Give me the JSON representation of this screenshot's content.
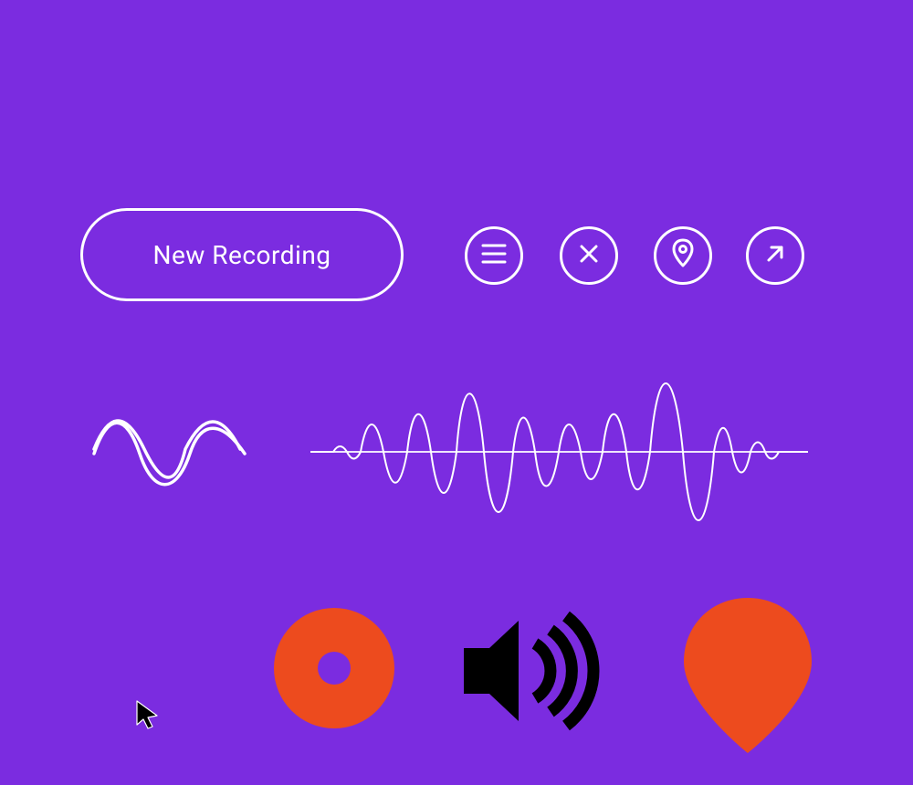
{
  "colors": {
    "background": "#7b2ce0",
    "stroke": "#ffffff",
    "accent": "#ed4b1e",
    "dark": "#000000"
  },
  "toolbar": {
    "new_recording_label": "New Recording"
  },
  "icons": {
    "menu": "menu-icon",
    "close": "close-icon",
    "pin": "pin-icon",
    "share": "share-arrow-icon",
    "wave_simple": "sine-wave-icon",
    "wave_audio": "audio-waveform-icon",
    "record": "record-icon",
    "speaker": "speaker-icon",
    "location": "location-marker-icon",
    "cursor": "cursor-icon"
  }
}
